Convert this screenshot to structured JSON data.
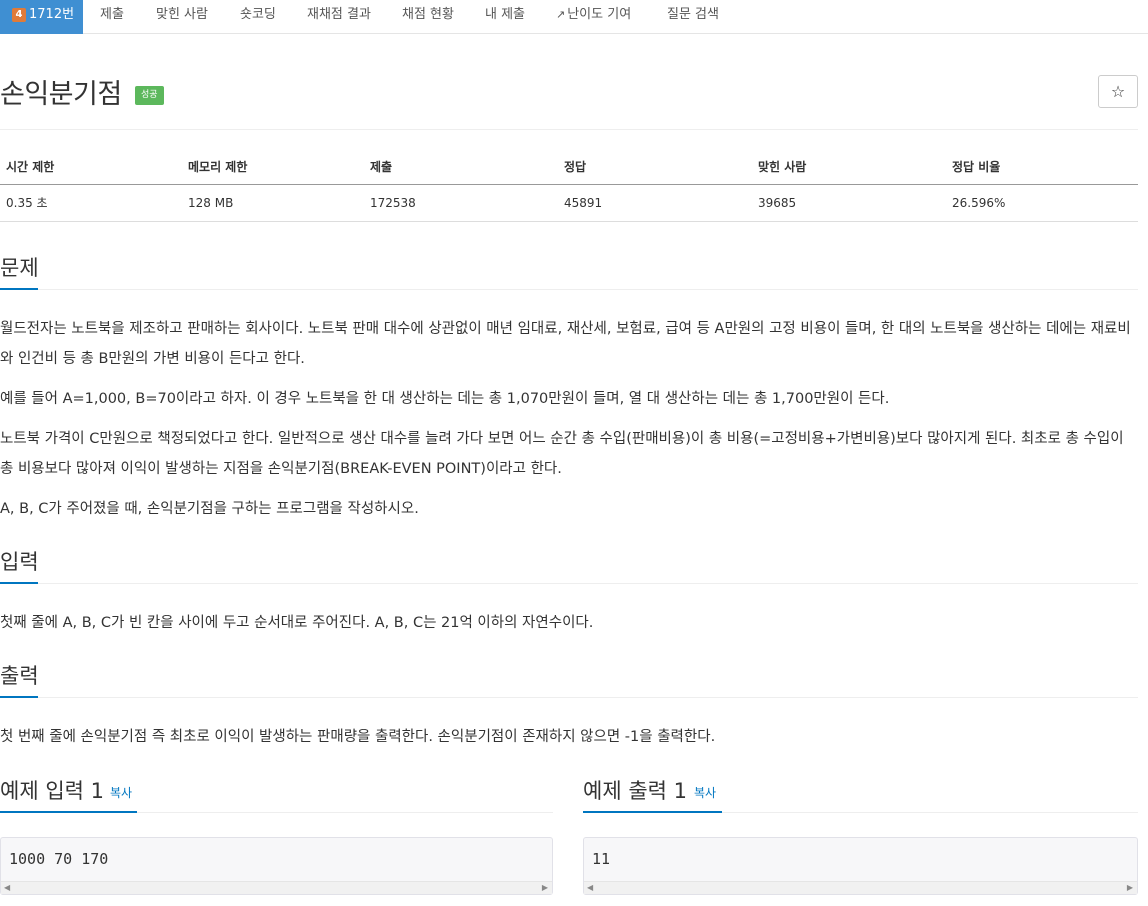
{
  "nav": {
    "problem_tab": "1712번",
    "tier_icon": "tier-icon",
    "tabs": [
      "제출",
      "맞힌 사람",
      "숏코딩",
      "재채점 결과",
      "채점 현황",
      "내 제출",
      "난이도 기여",
      "질문 검색"
    ]
  },
  "problem": {
    "title": "손익분기점",
    "status": "성공",
    "star": "☆"
  },
  "info": {
    "headers": [
      "시간 제한",
      "메모리 제한",
      "제출",
      "정답",
      "맞힌 사람",
      "정답 비율"
    ],
    "values": [
      "0.35 초",
      "128 MB",
      "172538",
      "45891",
      "39685",
      "26.596%"
    ]
  },
  "sections": {
    "problem_head": "문제",
    "p1": "월드전자는 노트북을 제조하고 판매하는 회사이다. 노트북 판매 대수에 상관없이 매년 임대료, 재산세, 보험료, 급여 등 A만원의 고정 비용이 들며, 한 대의 노트북을 생산하는 데에는 재료비와 인건비 등 총 B만원의 가변 비용이 든다고 한다.",
    "p2": "예를 들어 A=1,000, B=70이라고 하자. 이 경우 노트북을 한 대 생산하는 데는 총 1,070만원이 들며, 열 대 생산하는 데는 총 1,700만원이 든다.",
    "p3": "노트북 가격이 C만원으로 책정되었다고 한다. 일반적으로 생산 대수를 늘려 가다 보면 어느 순간 총 수입(판매비용)이 총 비용(=고정비용+가변비용)보다 많아지게 된다. 최초로 총 수입이 총 비용보다 많아져 이익이 발생하는 지점을 손익분기점(BREAK-EVEN POINT)이라고 한다.",
    "p4": "A, B, C가 주어졌을 때, 손익분기점을 구하는 프로그램을 작성하시오.",
    "input_head": "입력",
    "input_text": "첫째 줄에 A, B, C가 빈 칸을 사이에 두고 순서대로 주어진다. A, B, C는 21억 이하의 자연수이다.",
    "output_head": "출력",
    "output_text": "첫 번째 줄에 손익분기점 즉 최초로 이익이 발생하는 판매량을 출력한다. 손익분기점이 존재하지 않으면 -1을 출력한다."
  },
  "samples": {
    "input_head": "예제 입력 1",
    "output_head": "예제 출력 1",
    "copy": "복사",
    "input_value": "1000 70 170",
    "output_value": "11"
  }
}
